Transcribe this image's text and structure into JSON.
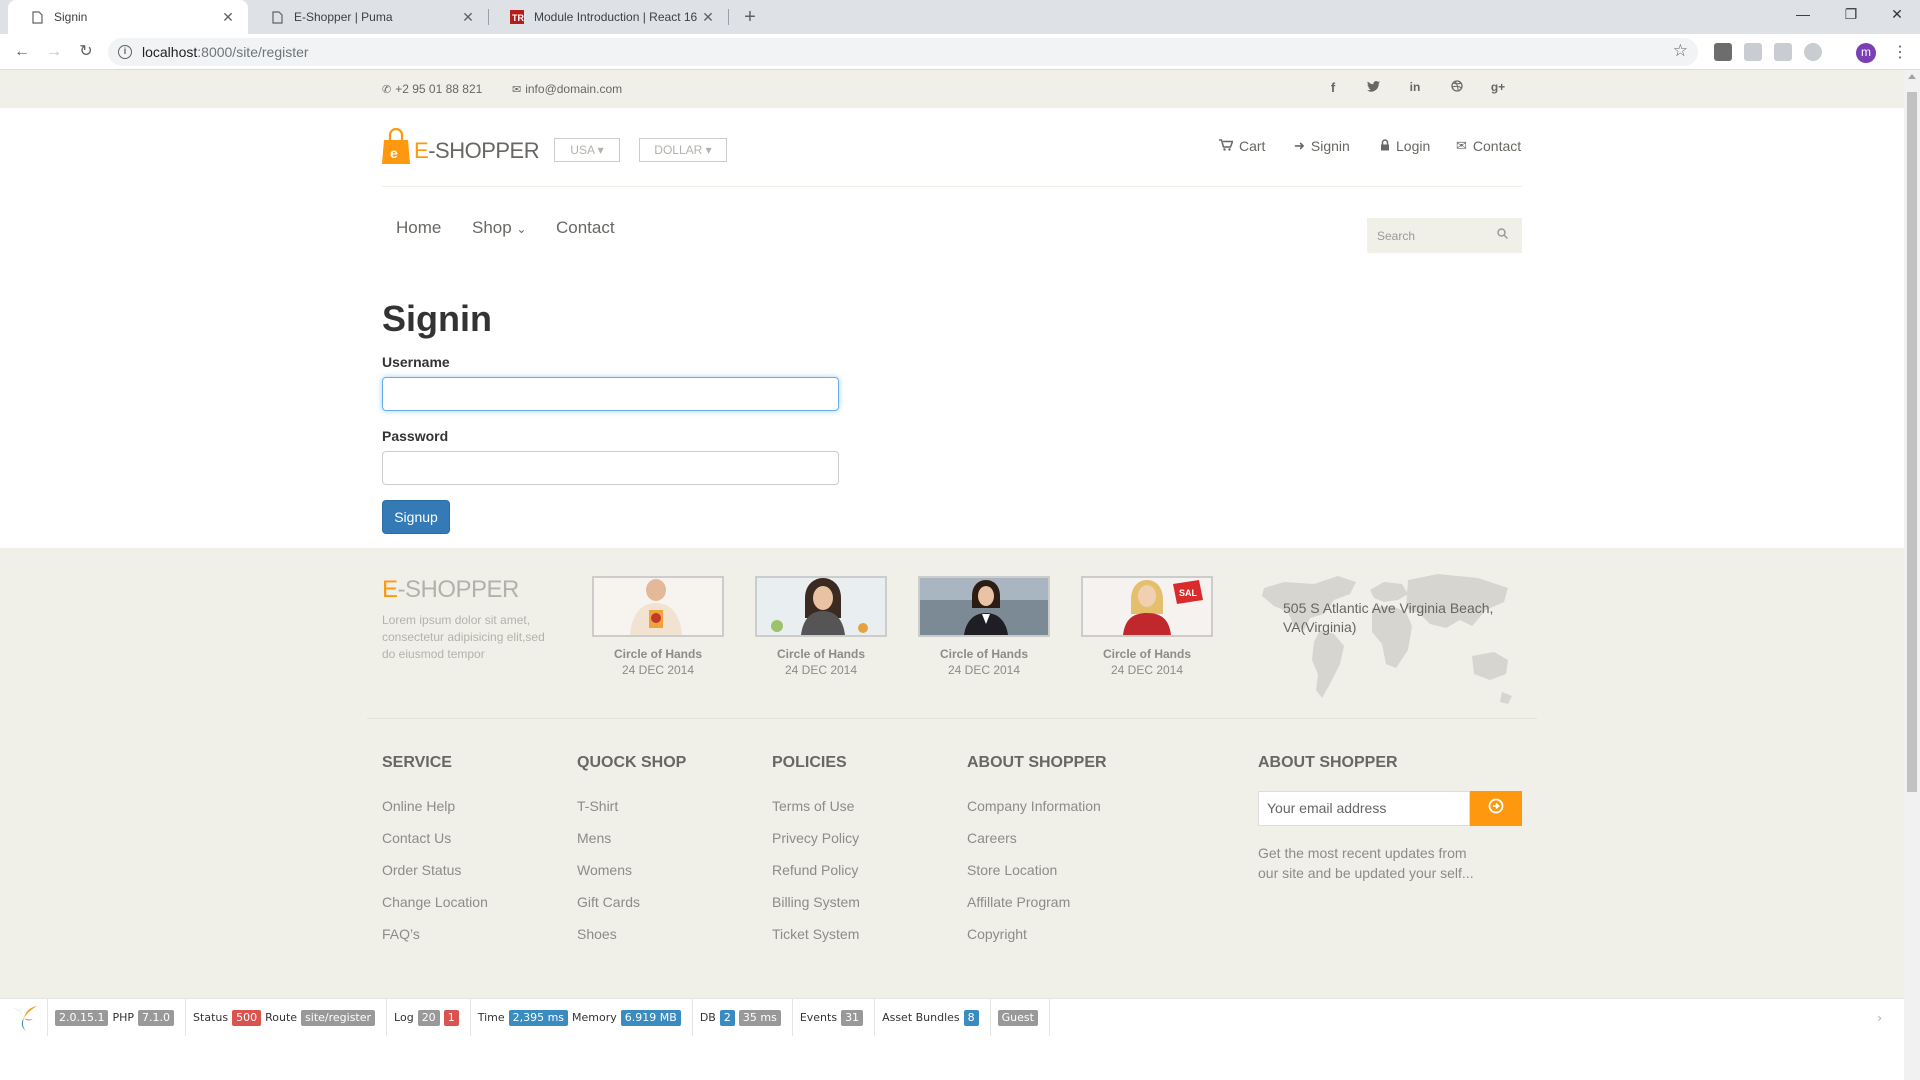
{
  "browser": {
    "tabs": [
      {
        "title": "Signin",
        "active": true
      },
      {
        "title": "E-Shopper | Puma",
        "active": false
      },
      {
        "title": "Module Introduction | React 16 -",
        "active": false
      }
    ],
    "url_host": "localhost",
    "url_path": ":8000/site/register",
    "profile_initial": "m"
  },
  "topbar": {
    "phone": "+2 95 01 88 821",
    "email": "info@domain.com",
    "social_icons": [
      "facebook-icon",
      "twitter-icon",
      "linkedin-icon",
      "dribbble-icon",
      "google-plus-icon"
    ]
  },
  "header": {
    "logo_e": "E",
    "logo_rest": "-SHOPPER",
    "country": "USA",
    "currency": "DOLLAR",
    "menu": [
      {
        "label": "Cart",
        "icon": "cart-icon"
      },
      {
        "label": "Signin",
        "icon": "sign-in-icon"
      },
      {
        "label": "Login",
        "icon": "lock-icon"
      },
      {
        "label": "Contact",
        "icon": "envelope-icon"
      }
    ]
  },
  "nav": {
    "items": [
      "Home",
      "Shop",
      "Contact"
    ],
    "search_placeholder": "Search"
  },
  "form": {
    "title": "Signin",
    "username_label": "Username",
    "username_value": "",
    "password_label": "Password",
    "password_value": "",
    "submit_label": "Signup"
  },
  "footer": {
    "logo_e": "E",
    "logo_rest": "-SHOPPER",
    "description": "Lorem ipsum dolor sit amet, consectetur adipisicing elit,sed do eiusmod tempor",
    "videos": [
      {
        "title": "Circle of Hands",
        "date": "24 DEC 2014"
      },
      {
        "title": "Circle of Hands",
        "date": "24 DEC 2014"
      },
      {
        "title": "Circle of Hands",
        "date": "24 DEC 2014"
      },
      {
        "title": "Circle of Hands",
        "date": "24 DEC 2014"
      }
    ],
    "address": "505 S Atlantic Ave Virginia Beach, VA(Virginia)",
    "columns": [
      {
        "title": "SERVICE",
        "links": [
          "Online Help",
          "Contact Us",
          "Order Status",
          "Change Location",
          "FAQ’s"
        ]
      },
      {
        "title": "QUOCK SHOP",
        "links": [
          "T-Shirt",
          "Mens",
          "Womens",
          "Gift Cards",
          "Shoes"
        ]
      },
      {
        "title": "POLICIES",
        "links": [
          "Terms of Use",
          "Privecy Policy",
          "Refund Policy",
          "Billing System",
          "Ticket System"
        ]
      },
      {
        "title": "ABOUT SHOPPER",
        "links": [
          "Company Information",
          "Careers",
          "Store Location",
          "Affillate Program",
          "Copyright"
        ]
      }
    ],
    "subscribe_title": "ABOUT SHOPPER",
    "subscribe_placeholder": "Your email address",
    "subscribe_text": "Get the most recent updates from our site and be updated your self..."
  },
  "debug": {
    "yii_version": "2.0.15.1",
    "php_label": "PHP",
    "php_version": "7.1.0",
    "status_label": "Status",
    "status": "500",
    "route_label": "Route",
    "route": "site/register",
    "log_label": "Log",
    "log_count": "20",
    "log_errors": "1",
    "time_label": "Time",
    "time": "2,395 ms",
    "memory_label": "Memory",
    "memory": "6.919 MB",
    "db_label": "DB",
    "db_queries": "2",
    "db_time": "35 ms",
    "events_label": "Events",
    "events": "31",
    "assets_label": "Asset Bundles",
    "assets": "8",
    "user": "Guest"
  },
  "colors": {
    "accent": "#fe980f",
    "primary_button": "#337ab7",
    "footer_bg": "#f0f0e9",
    "status_error": "#d9534f"
  }
}
